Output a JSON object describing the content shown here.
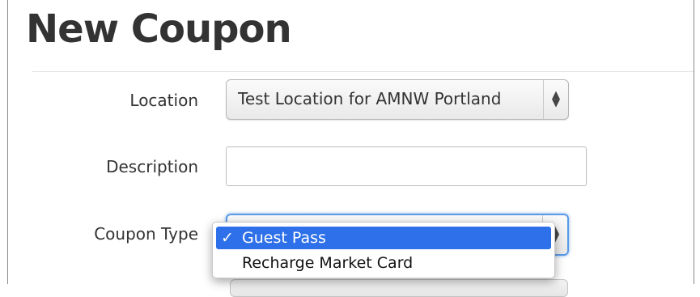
{
  "page": {
    "title": "New Coupon"
  },
  "form": {
    "location": {
      "label": "Location",
      "value": "Test Location for AMNW Portland",
      "arrows": "▴▾"
    },
    "description": {
      "label": "Description",
      "value": "",
      "placeholder": ""
    },
    "coupon_type": {
      "label": "Coupon Type",
      "arrows": "▴▾",
      "options": [
        {
          "label": "Guest Pass",
          "selected": true
        },
        {
          "label": "Recharge Market Card",
          "selected": false
        }
      ],
      "check_mark": "✓"
    }
  },
  "colors": {
    "selection": "#2e70e9",
    "focus_ring": "#5b9ae6",
    "title": "#333333"
  },
  "icons": {
    "select_arrows": "up-down-chevron-icon",
    "check": "checkmark-icon"
  }
}
